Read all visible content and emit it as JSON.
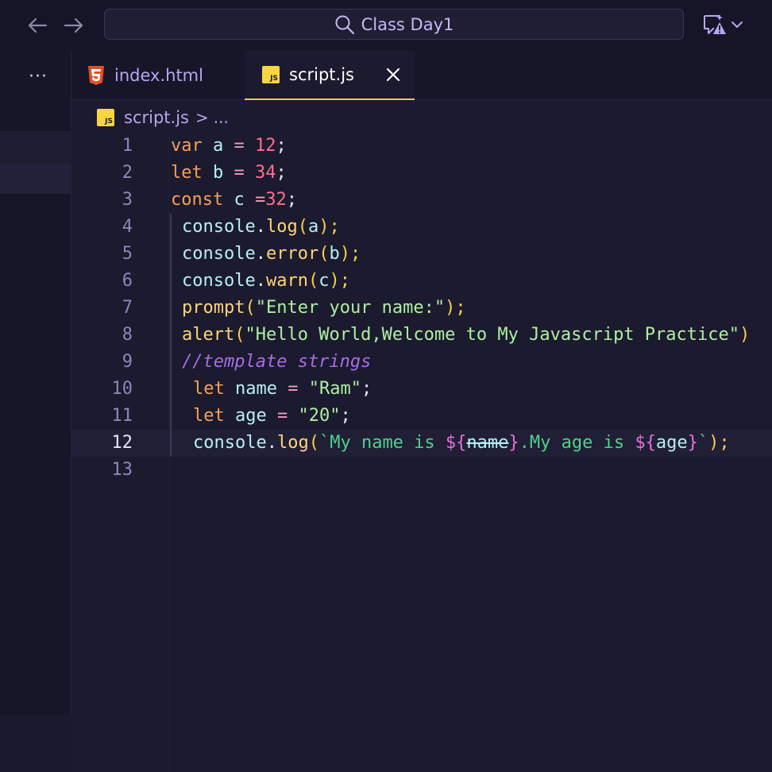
{
  "titlebar": {
    "search_text": "Class Day1",
    "icons": {
      "back": "arrow-left-icon",
      "forward": "arrow-right-icon",
      "search": "search-icon",
      "copilot": "copilot-warning-icon",
      "dropdown": "chevron-down-icon"
    }
  },
  "sidebar": {
    "more_label": "···"
  },
  "tabs": [
    {
      "label": "index.html",
      "icon": "html5-icon",
      "active": false
    },
    {
      "label": "script.js",
      "icon": "js-icon",
      "active": true
    }
  ],
  "breadcrumb": {
    "file": "script.js",
    "separator": ">",
    "more": "..."
  },
  "editor": {
    "current_line": 12,
    "line_numbers": [
      "1",
      "2",
      "3",
      "4",
      "5",
      "6",
      "7",
      "8",
      "9",
      "10",
      "11",
      "12",
      "13"
    ],
    "lines": [
      [
        "var",
        " a ",
        "=",
        " ",
        "12",
        ";"
      ],
      [
        "let",
        " b ",
        "=",
        " ",
        "34",
        ";"
      ],
      [
        "const",
        " c ",
        "=",
        "32",
        ";"
      ],
      [
        "console",
        ".",
        "log",
        "(",
        "a",
        ");"
      ],
      [
        "console",
        ".",
        "error",
        "(",
        "b",
        ");"
      ],
      [
        "console",
        ".",
        "warn",
        "(",
        "c",
        ");"
      ],
      [
        "prompt",
        "(",
        "\"Enter your name:\"",
        ");"
      ],
      [
        "alert",
        "(",
        "\"Hello World,Welcome to My Javascript Practice\"",
        ")"
      ],
      [
        "//template strings"
      ],
      [
        "let",
        " name ",
        "=",
        " ",
        "\"Ram\"",
        ";"
      ],
      [
        "let",
        " age ",
        "=",
        " ",
        "\"20\"",
        ";"
      ],
      [
        "console",
        ".",
        "log",
        "(",
        "`My name is ",
        "${",
        "name",
        "}",
        ".My age is ",
        "${",
        "age",
        "}",
        "`",
        ");"
      ],
      []
    ]
  },
  "colors": {
    "background": "#1b1a2e",
    "keyword": "#f5a05a",
    "number": "#ff6f91",
    "string": "#aef0a0",
    "template": "#4fd28a",
    "comment": "#a86de6",
    "active_tab_border": "#f2c94c"
  }
}
